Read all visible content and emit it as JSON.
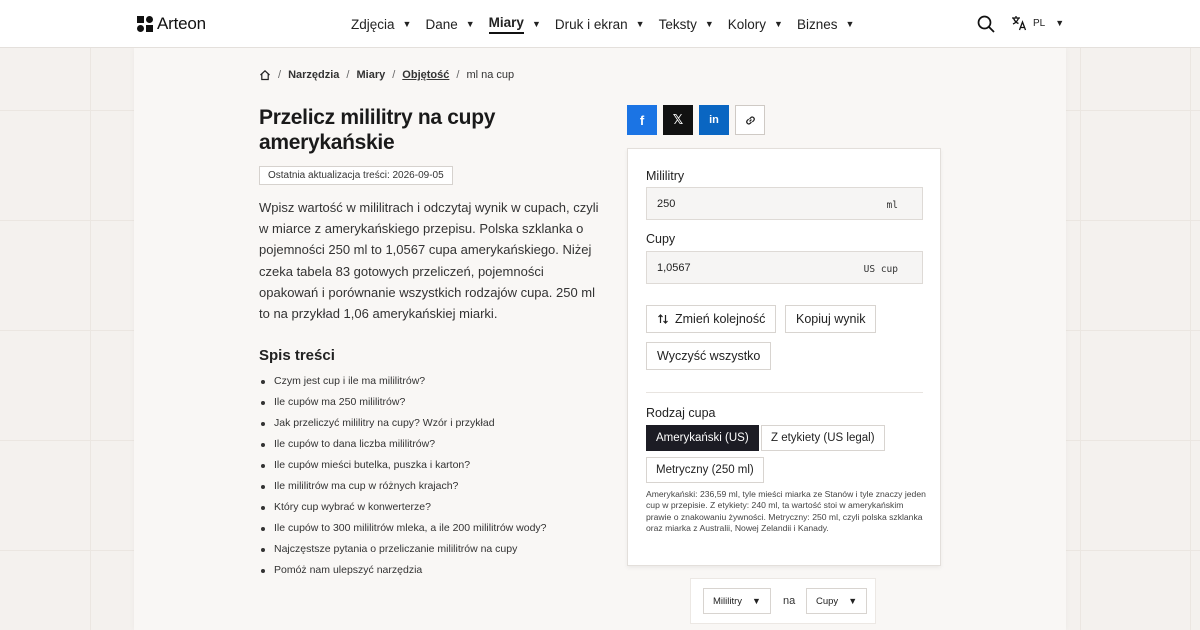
{
  "header": {
    "logo_text": "Arteon",
    "nav": [
      {
        "label": "Zdjęcia",
        "active": false
      },
      {
        "label": "Dane",
        "active": false
      },
      {
        "label": "Miary",
        "active": true
      },
      {
        "label": "Druk i ekran",
        "active": false
      },
      {
        "label": "Teksty",
        "active": false
      },
      {
        "label": "Kolory",
        "active": false
      },
      {
        "label": "Biznes",
        "active": false
      }
    ],
    "caret": "▼",
    "lang_code": "PL"
  },
  "breadcrumb": {
    "items": [
      "Narzędzia",
      "Miary",
      "Objętość"
    ],
    "current": "ml na cup",
    "sep": "/"
  },
  "page": {
    "title": "Przelicz mililitry na cupy amerykańskie",
    "updated": "Ostatnia aktualizacja treści: 2026-09-05",
    "intro": "Wpisz wartość w mililitrach i odczytaj wynik w cupach, czyli w miarce z amerykańskiego przepisu. Polska szklanka o pojemności 250 ml to 1,0567 cupa amerykańskiego. Niżej czeka tabela 83 gotowych przeliczeń, pojemności opakowań i porównanie wszystkich rodzajów cupa. 250 ml to na przykład 1,06 amerykańskiej miarki."
  },
  "toc": {
    "title": "Spis treści",
    "items": [
      "Czym jest cup i ile ma mililitrów?",
      "Ile cupów ma 250 mililitrów?",
      "Jak przeliczyć mililitry na cupy? Wzór i przykład",
      "Ile cupów to dana liczba mililitrów?",
      "Ile cupów mieści butelka, puszka i karton?",
      "Ile mililitrów ma cup w różnych krajach?",
      "Który cup wybrać w konwerterze?",
      "Ile cupów to 300 mililitrów mleka, a ile 200 mililitrów wody?",
      "Najczęstsze pytania o przeliczanie mililitrów na cupy",
      "Pomóż nam ulepszyć narzędzia"
    ]
  },
  "share": {
    "fb": "f",
    "x": "𝕏",
    "in": "in"
  },
  "converter": {
    "from_label": "Mililitry",
    "from_value": "250",
    "from_unit": "ml",
    "to_label": "Cupy",
    "to_value": "1,0567",
    "to_unit": "US cup",
    "swap_label": "Zmień kolejność",
    "copy_label": "Kopiuj wynik",
    "clear_label": "Wyczyść wszystko",
    "cup_type_label": "Rodzaj cupa",
    "cup_types": [
      "Amerykański (US)",
      "Z etykiety (US legal)",
      "Metryczny (250 ml)"
    ],
    "active_cup_type": 0,
    "note": "Amerykański: 236,59 ml, tyle mieści miarka ze Stanów i tyle znaczy jeden cup w przepisie. Z etykiety: 240 ml, ta wartość stoi w amerykańskim prawie o znakowaniu żywności. Metryczny: 250 ml, czyli polska szklanka oraz miarka z Australii, Nowej Zelandii i Kanady."
  },
  "unit_selector": {
    "from": "Mililitry",
    "connector": "na",
    "to": "Cupy"
  },
  "colors": {
    "accent_dark": "#1c1c24",
    "facebook": "#1b74e4",
    "linkedin": "#0a66c2"
  }
}
